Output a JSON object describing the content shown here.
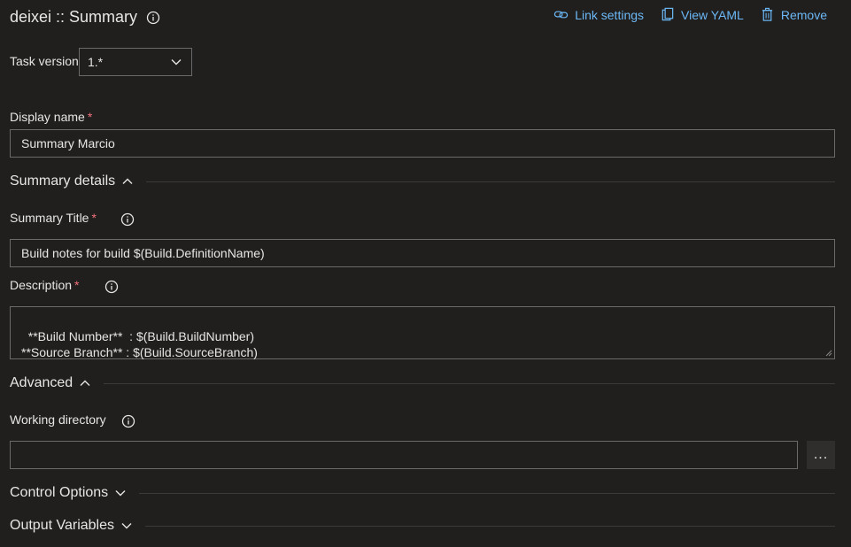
{
  "header": {
    "title": "deixei :: Summary",
    "actions": [
      {
        "label": "Link settings",
        "icon": "link-icon"
      },
      {
        "label": "View YAML",
        "icon": "clipboard-icon"
      },
      {
        "label": "Remove",
        "icon": "trash-icon"
      }
    ]
  },
  "task_version": {
    "label": "Task version",
    "value": "1.*"
  },
  "display_name": {
    "label": "Display name",
    "required_mark": "*",
    "value": "Summary Marcio"
  },
  "summary_details": {
    "title": "Summary details",
    "summary_title": {
      "label": "Summary Title",
      "required_mark": "*",
      "value": "Build notes for build $(Build.DefinitionName)"
    },
    "description": {
      "label": "Description",
      "required_mark": "*",
      "value": "**Build Number**  : $(Build.BuildNumber)\n**Source Branch** : $(Build.SourceBranch)"
    }
  },
  "advanced": {
    "title": "Advanced",
    "working_directory": {
      "label": "Working directory",
      "value": "",
      "browse_label": "..."
    }
  },
  "control_options": {
    "title": "Control Options"
  },
  "output_variables": {
    "title": "Output Variables"
  },
  "colors": {
    "accent": "#6cb8f6",
    "required": "#f1707b",
    "background": "#201f1e",
    "border": "#6a6a6a"
  }
}
